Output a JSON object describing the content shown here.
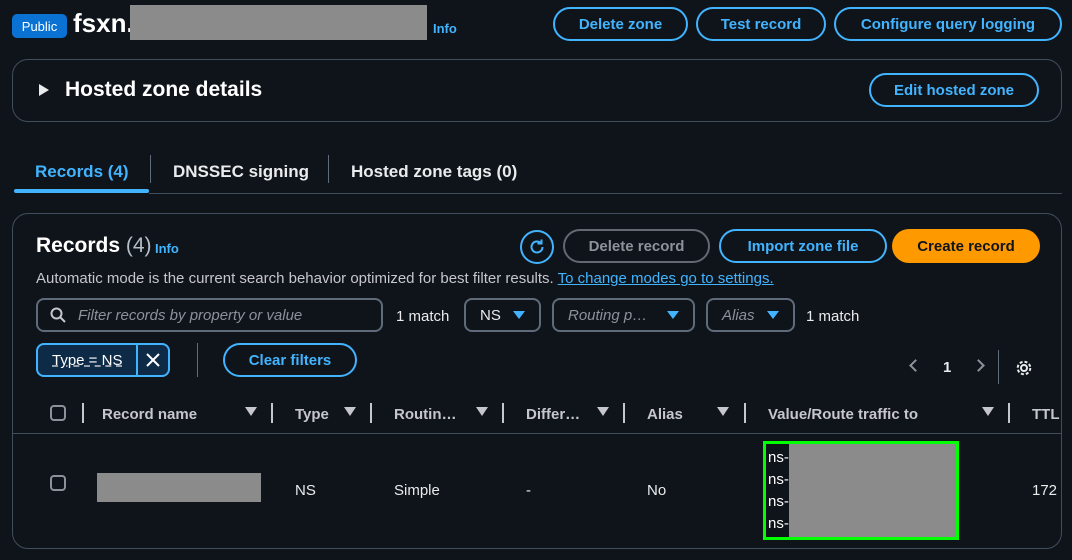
{
  "header": {
    "badge": "Public",
    "zone_name": "fsxn.",
    "info": "Info",
    "delete_zone": "Delete zone",
    "test_record": "Test record",
    "configure_query_logging": "Configure query logging"
  },
  "details": {
    "title": "Hosted zone details",
    "edit": "Edit hosted zone"
  },
  "tabs": [
    {
      "label": "Records (4)",
      "active": true
    },
    {
      "label": "DNSSEC signing",
      "active": false
    },
    {
      "label": "Hosted zone tags (0)",
      "active": false
    }
  ],
  "records": {
    "title": "Records",
    "count": "(4)",
    "info": "Info",
    "delete_record": "Delete record",
    "import_zone_file": "Import zone file",
    "create_record": "Create record",
    "mode_text": "Automatic mode is the current search behavior optimized for best filter results.",
    "mode_link": "To change modes go to settings.",
    "search_placeholder": "Filter records by property or value",
    "match_1": "1 match",
    "type_select": "NS",
    "routing_select": "Routing p…",
    "alias_select": "Alias",
    "match_2": "1 match",
    "token": "Type = NS",
    "clear_filters": "Clear filters",
    "page": "1"
  },
  "table": {
    "headers": [
      "Record name",
      "Type",
      "Routin…",
      "Differ…",
      "Alias",
      "Value/Route traffic to",
      "TTL"
    ],
    "row": {
      "type": "NS",
      "routing": "Simple",
      "differentiator": "-",
      "alias": "No",
      "values": [
        "ns-",
        "ns-",
        "ns-",
        "ns-"
      ],
      "ttl": "172"
    }
  },
  "colors": {
    "accent": "#42b4ff",
    "primary": "#ff9900",
    "badge": "#0972d3",
    "highlight": "#00ff00"
  }
}
